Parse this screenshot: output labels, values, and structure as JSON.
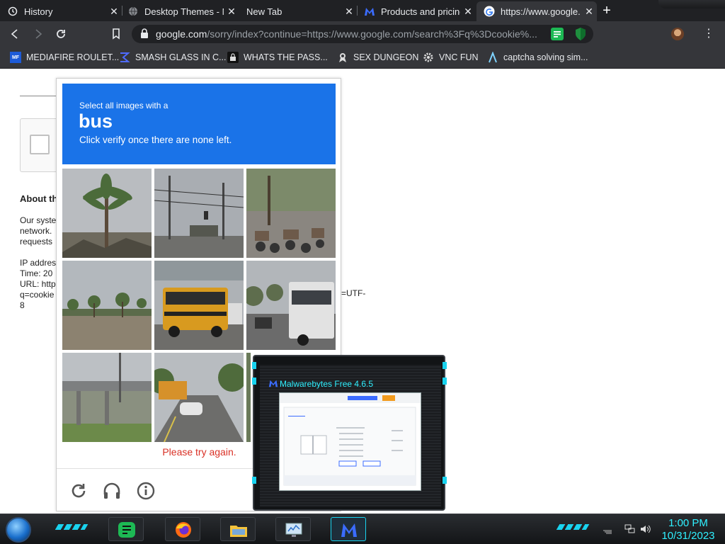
{
  "browser": {
    "tabs": [
      {
        "title": "History",
        "icon": "history-icon",
        "active": false
      },
      {
        "title": "Desktop Themes - M",
        "icon": "globe-icon",
        "active": false
      },
      {
        "title": "New Tab",
        "icon": "",
        "active": false
      },
      {
        "title": "Products and pricing",
        "icon": "malwarebytes-icon",
        "active": false
      },
      {
        "title": "https://www.google.",
        "icon": "google-icon",
        "active": true
      }
    ],
    "url_host": "google.com",
    "url_rest": "/sorry/index?continue=https://www.google.com/search%3Fq%3Dcookie%...",
    "bookmarks": [
      {
        "label": "MEDIAFIRE ROULET...",
        "icon": "mediafire-icon"
      },
      {
        "label": "SMASH GLASS IN C...",
        "icon": "smash-glass-icon"
      },
      {
        "label": "WHATS THE PASS...",
        "icon": "lock-badge-icon"
      },
      {
        "label": "SEX DUNGEON",
        "icon": "ribbon-icon"
      },
      {
        "label": "VNC FUN",
        "icon": "gear-icon"
      },
      {
        "label": "captcha solving sim...",
        "icon": "lambda-icon"
      }
    ]
  },
  "page": {
    "about_title": "About th",
    "para1": [
      "Our syste",
      "network.",
      "requests"
    ],
    "info": [
      "IP addres",
      "Time: 20",
      "URL: http",
      "q=cookie",
      "8"
    ],
    "utf_tail": "=UTF-"
  },
  "captcha": {
    "instruction_pre": "Select all images with a",
    "target_word": "bus",
    "instruction_post": "Click verify once there are none left.",
    "error": "Please try again.",
    "tiles": [
      "palm tree",
      "power lines",
      "parked motorcycles",
      "palm trees",
      "school bus",
      "city bus",
      "highway overpass",
      "school bus on road",
      "street"
    ]
  },
  "malwarebytes": {
    "title": "Malwarebytes Free  4.6.5",
    "scanner_label": "Scanner",
    "tabs": [
      "Scanner",
      "Scan Scheduler",
      "Reports"
    ]
  },
  "taskbar": {
    "time": "1:00 PM",
    "date": "10/31/2023"
  },
  "colors": {
    "captcha_blue": "#1a73e8",
    "error_red": "#d93025",
    "theme_cyan": "#2ff0ff"
  }
}
